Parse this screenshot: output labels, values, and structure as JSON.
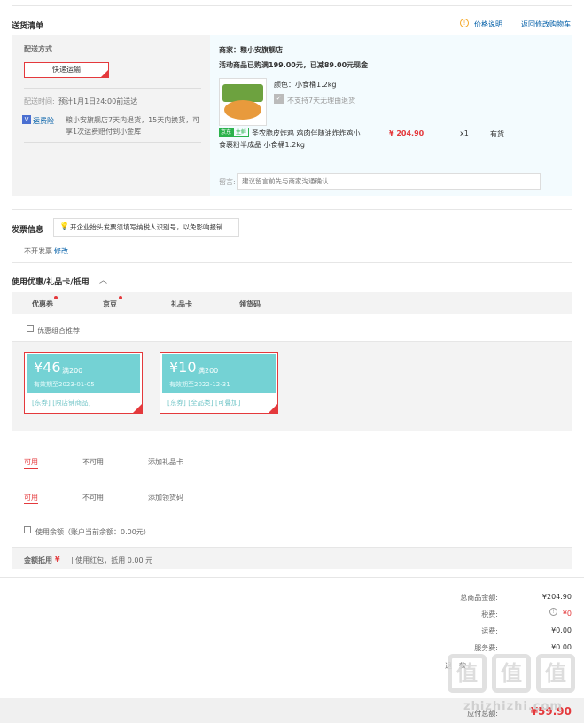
{
  "delivery": {
    "section_title": "送货清单",
    "price_note": "价格说明",
    "back_to_cart": "返回修改购物车",
    "method_label": "配送方式",
    "method_value": "快递运输",
    "time_label": "配送时间:",
    "time_value": "预计1月1日24:00前送达",
    "insurance_badge": "运费险",
    "insurance_text": "粮小安旗舰店7天内退货，15天内换货，可享1次运费赔付到小金库"
  },
  "shop": {
    "merchant": "商家：粮小安旗舰店",
    "promo": "活动商品已购满199.00元，已减89.00元现金",
    "color": "颜色：小食桶1.2kg",
    "no_return": "不支持7天无理由退货",
    "jd_tag": "京东",
    "fresh_tag": "生鲜",
    "product_name": "圣农脆皮炸鸡 鸡肉伴随油炸炸鸡小食裹粉半成品 小食桶1.2kg",
    "price": "¥ 204.90",
    "qty": "x1",
    "stock": "有货",
    "note_label": "留言:",
    "note_placeholder": "建议留言前先与商家沟通确认"
  },
  "invoice": {
    "title": "发票信息",
    "tip": "开企业抬头发票须填写纳税人识别号，以免影响报销",
    "value": "不开发票",
    "edit": "修改"
  },
  "coupons": {
    "title": "使用优惠/礼品卡/抵用",
    "tabs": [
      "优惠券",
      "京豆",
      "礼品卡",
      "领货码"
    ],
    "combo": "优惠组合推荐",
    "items": [
      {
        "amount": "¥46",
        "cond": "满200",
        "expire": "有效期至2023-01-05",
        "tags": "[东券]  [限店铺商品]"
      },
      {
        "amount": "¥10",
        "cond": "满200",
        "expire": "有效期至2022-12-31",
        "tags": "[东券]  [全品类]  [可叠加]"
      }
    ],
    "gift_row": {
      "available": "可用",
      "unavailable": "不可用",
      "add": "添加礼品卡"
    },
    "code_row": {
      "available": "可用",
      "unavailable": "不可用",
      "add": "添加领货码"
    },
    "balance": "使用余额（账户当前余额：0.00元）",
    "deduct_label": "金额抵用",
    "deduct_symbol": "¥",
    "deduct_text": "| 使用红包，抵用 0.00 元"
  },
  "summary": {
    "total_goods_label": "总商品金额:",
    "total_goods": "¥204.90",
    "tax_label": "税费:",
    "tax": "¥0",
    "shipping_label": "运费:",
    "shipping": "¥0.00",
    "service_label": "服务费:",
    "service": "¥0.00",
    "cut_label_1": "退",
    "cut_label_2": "款",
    "payable_label": "应付总额:",
    "payable": "¥59.90"
  },
  "watermark": {
    "line1": "值",
    "site": "zhizhizhi.com"
  },
  "colors": {
    "accent_red": "#e4393c",
    "link_blue": "#005ea7",
    "coupon_teal": "#74d2d4",
    "jd_green": "#2bb24c"
  }
}
